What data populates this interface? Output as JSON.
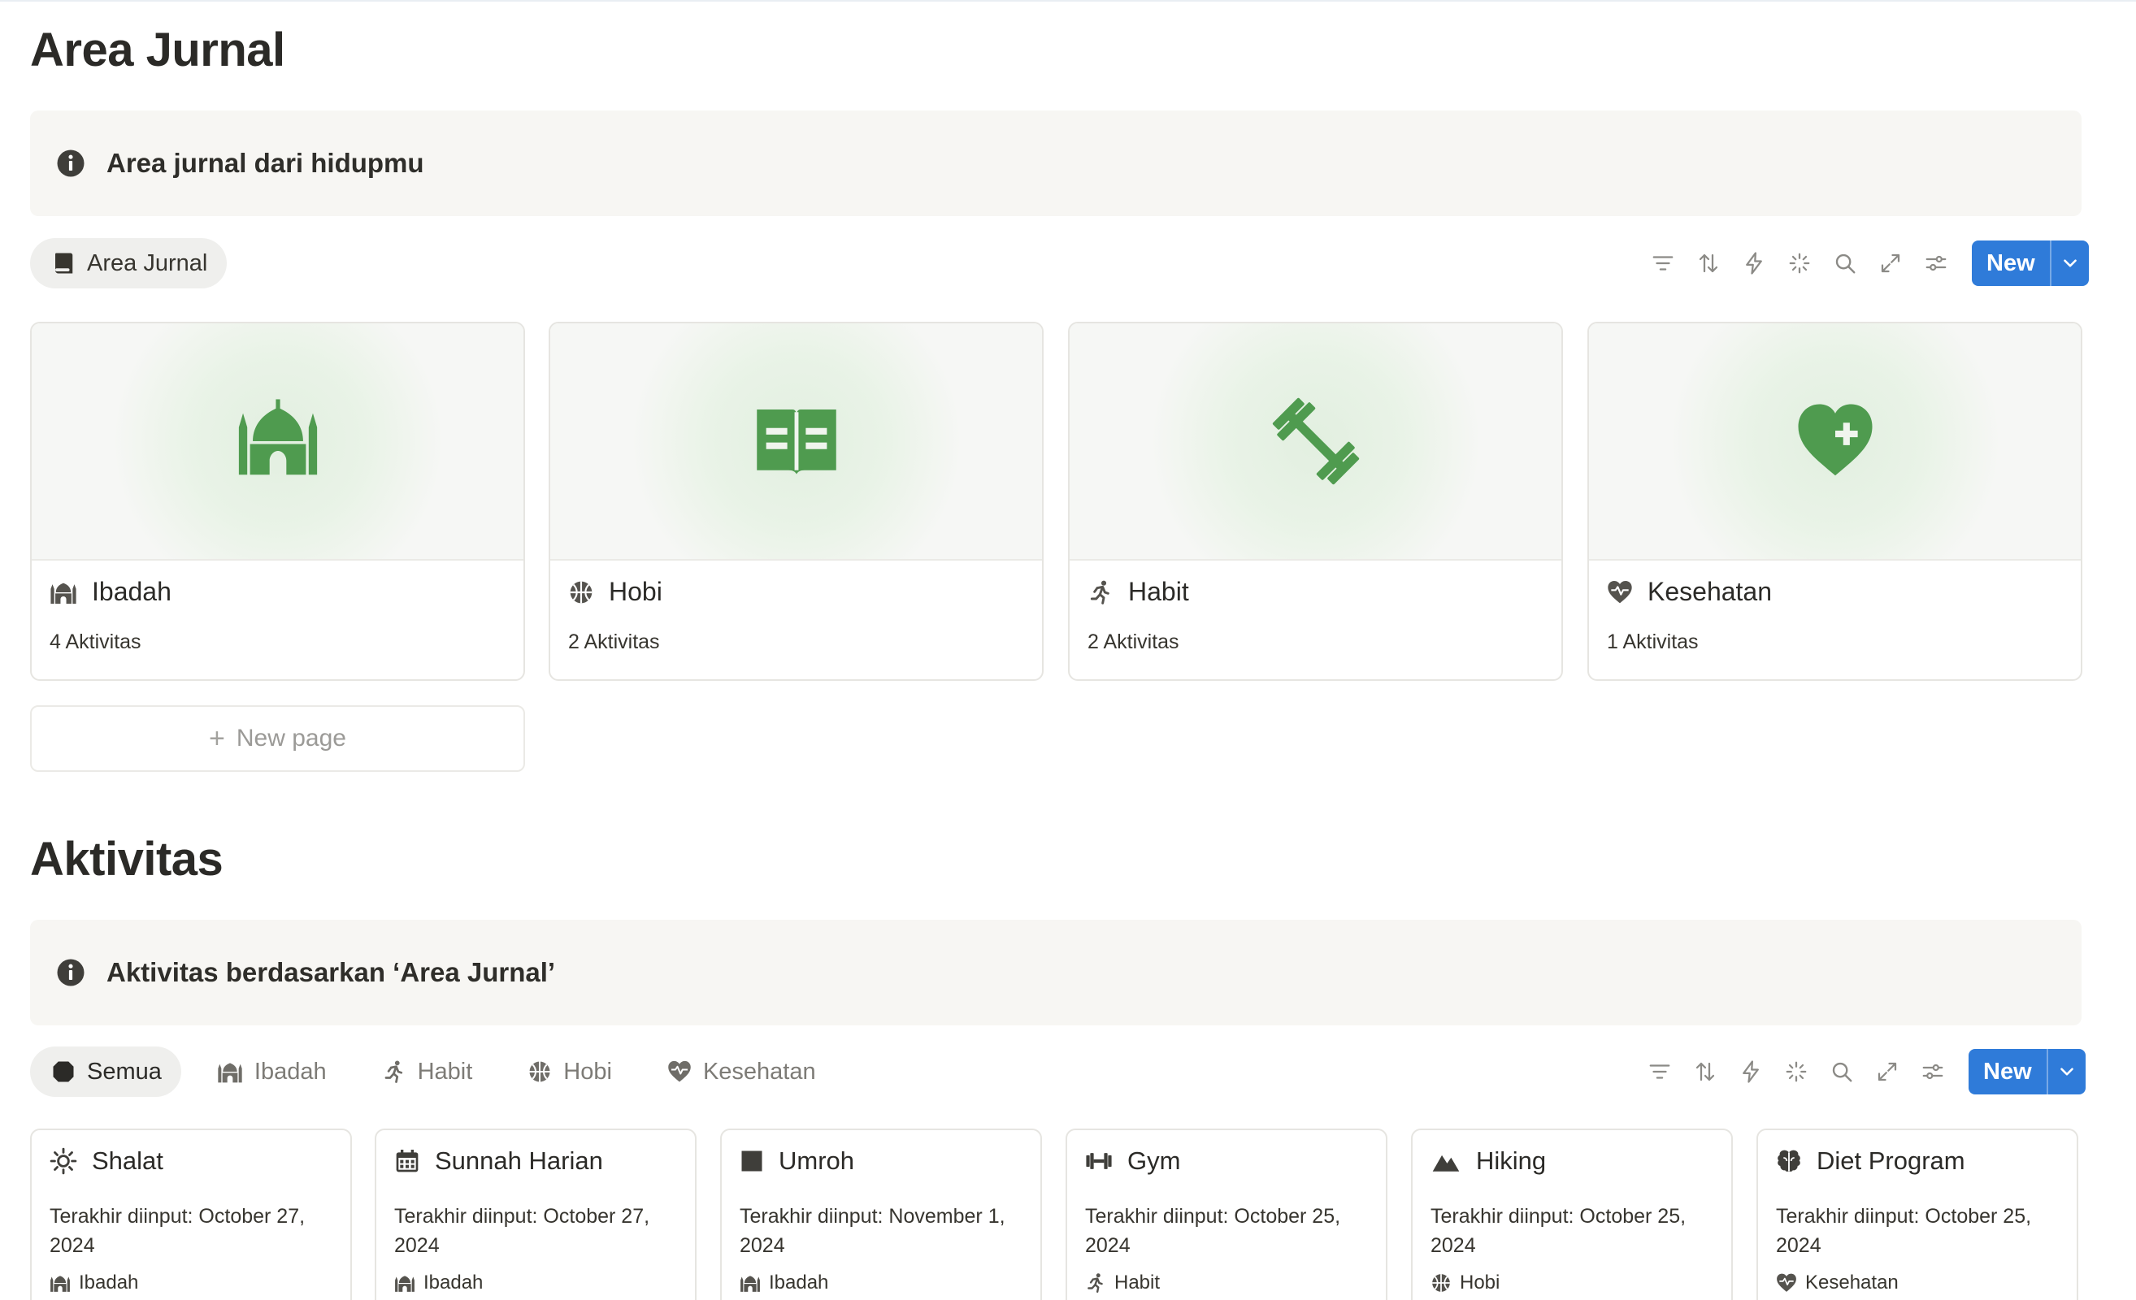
{
  "colors": {
    "accent": "#2f7bd9",
    "icon_green": "#4f9b4f",
    "callout_bg": "#f7f6f3"
  },
  "section1": {
    "title": "Area Jurnal",
    "callout": "Area jurnal dari hidupmu",
    "view_tab": "Area Jurnal",
    "new_label": "New",
    "cards": [
      {
        "icon": "mosque-icon",
        "cover_icon": "mosque-icon",
        "name": "Ibadah",
        "count": "4 Aktivitas"
      },
      {
        "icon": "basketball-icon",
        "cover_icon": "book-icon",
        "name": "Hobi",
        "count": "2 Aktivitas"
      },
      {
        "icon": "running-icon",
        "cover_icon": "barbell-icon",
        "name": "Habit",
        "count": "2 Aktivitas"
      },
      {
        "icon": "heart-pulse-icon",
        "cover_icon": "heart-plus-icon",
        "name": "Kesehatan",
        "count": "1 Aktivitas"
      }
    ],
    "new_page": "New page"
  },
  "section2": {
    "title": "Aktivitas",
    "callout": "Aktivitas berdasarkan ‘Area Jurnal’",
    "tabs": [
      "Semua",
      "Ibadah",
      "Habit",
      "Hobi",
      "Kesehatan"
    ],
    "active_tab": "Semua",
    "new_label": "New",
    "cards": [
      {
        "icon": "sun-icon",
        "name": "Shalat",
        "desc": "Terakhir diinput: October 27, 2024",
        "area": "Ibadah"
      },
      {
        "icon": "calendar-icon",
        "name": "Sunnah Harian",
        "desc": "Terakhir diinput: October 27, 2024",
        "area": "Ibadah"
      },
      {
        "icon": "square-icon",
        "name": "Umroh",
        "desc": "Terakhir diinput: November 1, 2024",
        "area": "Ibadah"
      },
      {
        "icon": "dumbbell-icon",
        "name": "Gym",
        "desc": "Terakhir diinput: October 25, 2024",
        "area": "Habit"
      },
      {
        "icon": "mountain-icon",
        "name": "Hiking",
        "desc": "Terakhir diinput: October 25, 2024",
        "area": "Hobi"
      },
      {
        "icon": "brain-icon",
        "name": "Diet Program",
        "desc": "Terakhir diinput: October 25, 2024",
        "area": "Kesehatan"
      }
    ]
  }
}
